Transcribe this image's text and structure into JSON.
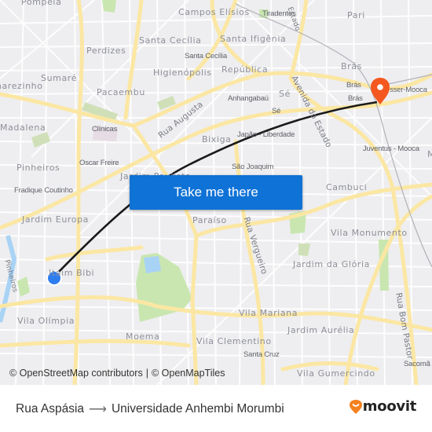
{
  "map": {
    "labels": {
      "pompeia": "Pompéia",
      "campos_eliseos": "Campos Elísios",
      "tiradentes": "Tiradentes",
      "estado_top": "Estado",
      "pari": "Pari",
      "perdizes": "Perdizes",
      "santa_cecilia": "Santa Cecília",
      "santa_cecilia_station": "Santa Cecília",
      "santa_ifigenia": "Santa Ifigênia",
      "higienopolis": "Higienópolis",
      "republica": "República",
      "bras": "Brás",
      "bras_station_1": "Brás",
      "bras_station_2": "Brás",
      "bresser_mooca": "Bresser-Mooca",
      "sumare": "Sumaré",
      "vila_madalena_top": "Sumarezinho",
      "pacaembu": "Pacaembu",
      "anhangabau": "Anhangabaú",
      "se": "Sé",
      "se_station": "Sé",
      "avenida_do_estado": "Avenida do Estado",
      "madalena": "Madalena",
      "clinicas": "Clínicas",
      "rua_augusta": "Rua Augusta",
      "bixiga": "Bixiga",
      "japao_liberdade": "Japão - Liberdade",
      "juventus_mooca": "Juventus - Mooca",
      "mooca_edge": "M",
      "pinheiros": "Pinheiros",
      "oscar_freire": "Oscar Freire",
      "jardim_paulista": "Jardim Paulista",
      "sao_joaquim": "São Joaquim",
      "cambuci": "Cambuci",
      "fradique_coutinho": "Fradique Coutinho",
      "jardim_europa": "Jardim Europa",
      "paraiso": "Paraíso",
      "rua_vergueiro": "Rua Vergueiro",
      "vila_monumento": "Vila Monumento",
      "itaim_bibi": "Itaim Bibi",
      "pinheiros_river": "Pinheiros",
      "jardim_da_gloria": "Jardim da Glória",
      "rua_bom_pastor": "Rua Bom Pastor",
      "vila_olimpia": "Vila Olímpia",
      "vila_mariana": "Vila Mariana",
      "jardim_aurelia": "Jardim Aurélia",
      "moema": "Moema",
      "vila_clementino": "Vila Clementino",
      "santa_cruz": "Santa Cruz",
      "sacoma": "Sacomã",
      "vila_gumercindo": "Vila Gumercindo"
    },
    "colors": {
      "background": "#eeeef0",
      "road": "#fbe7a3",
      "park": "#c9e6b0",
      "water": "#a9d3f5",
      "route_line": "#1a1a1a",
      "origin_marker": "#2f7ef0",
      "destination_marker": "#f4581e",
      "button": "#0f72d6"
    }
  },
  "cta": {
    "label": "Take me there"
  },
  "attribution": {
    "osm": "© OpenStreetMap contributors",
    "separator": "|",
    "omt": "© OpenMapTiles"
  },
  "footer": {
    "origin": "Rua Aspásia",
    "arrow": "⟶",
    "destination": "Universidade Anhembi Morumbi",
    "brand": "moovit"
  }
}
